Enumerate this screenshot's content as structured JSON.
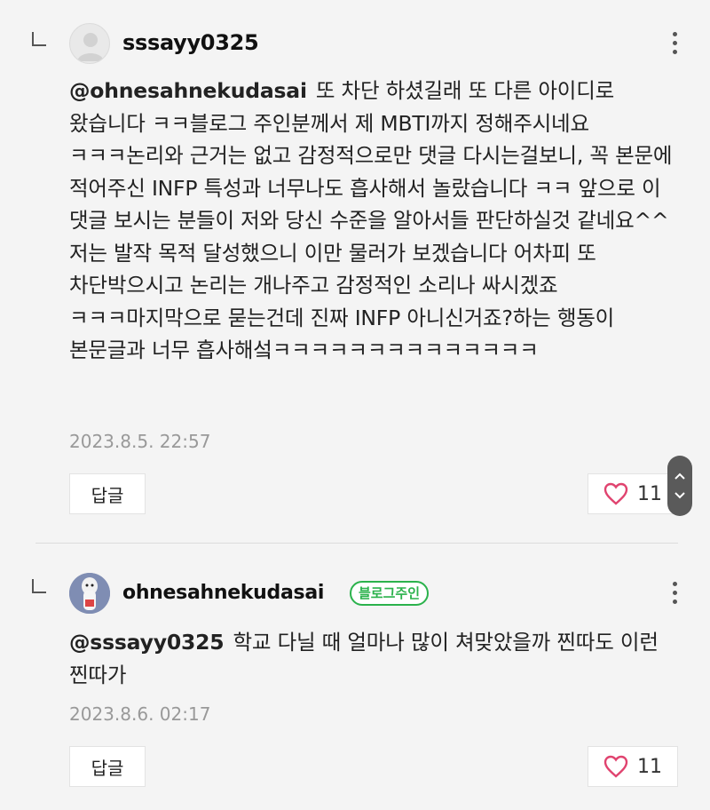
{
  "comments": [
    {
      "author": "sssayy0325",
      "mention": "@ohnesahnekudasai",
      "text": "또 차단 하셨길래 또 다른 아이디로 왔습니다 ㅋㅋ블로그 주인분께서 제 MBTI까지 정해주시네요 ㅋㅋㅋ논리와 근거는 없고 감정적으로만 댓글 다시는걸보니, 꼭 본문에 적어주신 INFP 특성과 너무나도 흡사해서 놀랐습니다 ㅋㅋ 앞으로 이 댓글 보시는 분들이 저와 당신 수준을 알아서들 판단하실것 같네요^^저는 발작 목적 달성했으니 이만 물러가 보겠습니다 어차피 또 차단박으시고 논리는 개나주고 감정적인 소리나 싸시겠죠 ㅋㅋㅋ마지막으로 묻는건데 진짜 INFP 아니신거죠?하는 행동이 본문글과 너무 흡사해섴ㅋㅋㅋㅋㅋㅋㅋㅋㅋㅋㅋㅋㅋㅋ",
      "date": "2023.8.5. 22:57",
      "reply_label": "답글",
      "likes": "11"
    },
    {
      "author": "ohnesahnekudasai",
      "badge": "블로그주인",
      "mention": "@sssayy0325",
      "text": "학교 다닐 때 얼마나 많이 쳐맞았을까 찐따도 이런 찐따가",
      "date": "2023.8.6. 02:17",
      "reply_label": "답글",
      "likes": "11"
    }
  ],
  "colors": {
    "background": "#f4f4f4",
    "badge_green": "#2bb24c",
    "date_gray": "#999999",
    "heart_pink": "#e0436f"
  },
  "icons": [
    "reply-arrow-icon",
    "more-options-icon",
    "heart-icon",
    "chevron-up-icon",
    "chevron-down-icon"
  ]
}
